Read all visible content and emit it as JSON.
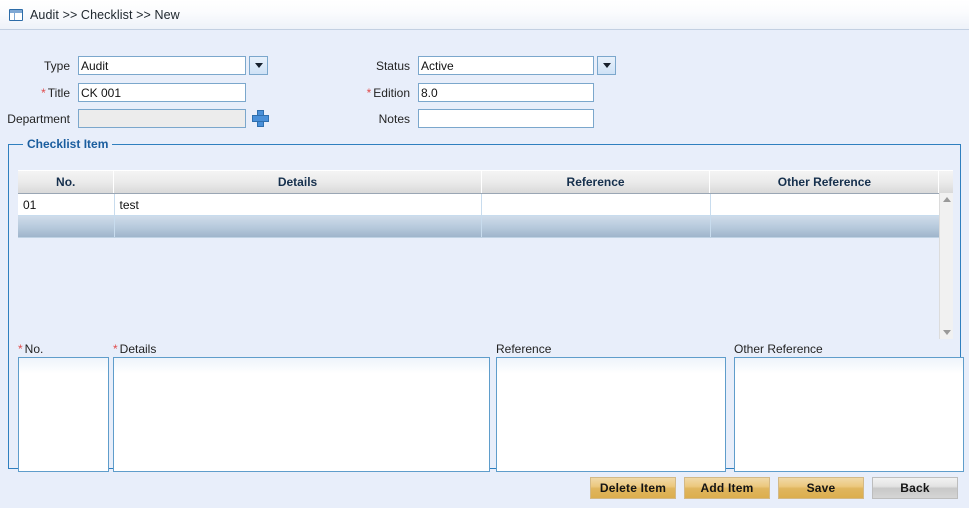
{
  "breadcrumb": {
    "icon": "window-panel-icon",
    "text": "Audit >> Checklist >> New"
  },
  "form": {
    "type": {
      "label": "Type",
      "value": "Audit",
      "required": false,
      "dropdown": true
    },
    "title": {
      "label": "Title",
      "value": "CK 001",
      "required": true,
      "dropdown": false
    },
    "department": {
      "label": "Department",
      "value": "",
      "required": false,
      "disabled": true,
      "add_icon": "plus-icon"
    },
    "status": {
      "label": "Status",
      "value": "Active",
      "required": false,
      "dropdown": true
    },
    "edition": {
      "label": "Edition",
      "value": "8.0",
      "required": true,
      "dropdown": false
    },
    "notes": {
      "label": "Notes",
      "value": "",
      "required": false,
      "dropdown": false
    }
  },
  "checklist": {
    "legend": "Checklist Item",
    "columns": [
      "No.",
      "Details",
      "Reference",
      "Other Reference"
    ],
    "rows": [
      {
        "no": "01",
        "details": "test",
        "reference": "",
        "other_reference": "",
        "selected": false
      },
      {
        "no": "",
        "details": "",
        "reference": "",
        "other_reference": "",
        "selected": true
      }
    ],
    "scrollbar": {
      "up_icon": "scroll-up-arrow-icon",
      "down_icon": "scroll-down-arrow-icon"
    }
  },
  "editors": {
    "no": {
      "label": "No.",
      "required": true,
      "value": ""
    },
    "details": {
      "label": "Details",
      "required": true,
      "value": ""
    },
    "reference": {
      "label": "Reference",
      "required": false,
      "value": ""
    },
    "other_reference": {
      "label": "Other Reference",
      "required": false,
      "value": ""
    }
  },
  "buttons": {
    "delete_item": "Delete Item",
    "add_item": "Add Item",
    "save": "Save",
    "back": "Back"
  },
  "colors": {
    "page_background": "#e8eefa",
    "accent_blue": "#2f7fbf",
    "legend_blue": "#1a5d9e",
    "required_red": "#e04b4b",
    "button_gold": "#e0b65f",
    "button_grey": "#c8c8c8",
    "selected_row": "#b6c9dc"
  }
}
